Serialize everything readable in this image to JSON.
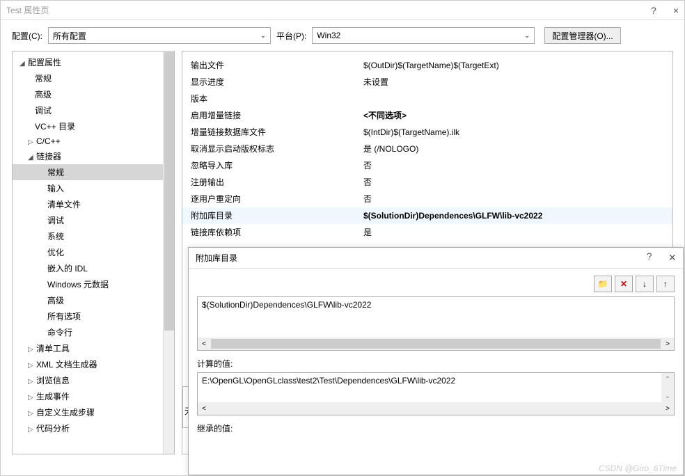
{
  "window": {
    "title": "Test 属性页",
    "help": "?",
    "close": "×"
  },
  "toolbar": {
    "config_label": "配置(C):",
    "config_value": "所有配置",
    "platform_label": "平台(P):",
    "platform_value": "Win32",
    "manager_btn": "配置管理器(O)..."
  },
  "tree": {
    "root": "配置属性",
    "items": [
      "常规",
      "高级",
      "调试",
      "VC++ 目录"
    ],
    "cc": "C/C++",
    "linker": "链接器",
    "linker_items": [
      "常规",
      "输入",
      "清单文件",
      "调试",
      "系统",
      "优化",
      "嵌入的 IDL",
      "Windows 元数据",
      "高级",
      "所有选项",
      "命令行"
    ],
    "after": [
      "清单工具",
      "XML 文档生成器",
      "浏览信息",
      "生成事件",
      "自定义生成步骤",
      "代码分析"
    ]
  },
  "props": [
    {
      "k": "输出文件",
      "v": "$(OutDir)$(TargetName)$(TargetExt)",
      "b": false
    },
    {
      "k": "显示进度",
      "v": "未设置",
      "b": false
    },
    {
      "k": "版本",
      "v": "",
      "b": false
    },
    {
      "k": "启用增量链接",
      "v": "<不同选项>",
      "b": true
    },
    {
      "k": "增量链接数据库文件",
      "v": "$(IntDir)$(TargetName).ilk",
      "b": false
    },
    {
      "k": "取消显示启动版权标志",
      "v": "是 (/NOLOGO)",
      "b": false
    },
    {
      "k": "忽略导入库",
      "v": "否",
      "b": false
    },
    {
      "k": "注册输出",
      "v": "否",
      "b": false
    },
    {
      "k": "逐用户重定向",
      "v": "否",
      "b": false
    },
    {
      "k": "附加库目录",
      "v": "$(SolutionDir)Dependences\\GLFW\\lib-vc2022",
      "b": true
    },
    {
      "k": "链接库依赖项",
      "v": "是",
      "b": false
    }
  ],
  "dialog": {
    "title": "附加库目录",
    "help": "?",
    "close": "×",
    "value": "$(SolutionDir)Dependences\\GLFW\\lib-vc2022",
    "computed_label": "计算的值:",
    "computed_value": "E:\\OpenGL\\OpenGLclass\\test2\\Test\\Dependences\\GLFW\\lib-vc2022",
    "inherited_label": "继承的值:",
    "icons": {
      "new": "📁",
      "delete": "✕",
      "down": "↓",
      "up": "↑"
    }
  },
  "watermark": "CSDN @Giro_6Time",
  "fragment_char": "无"
}
